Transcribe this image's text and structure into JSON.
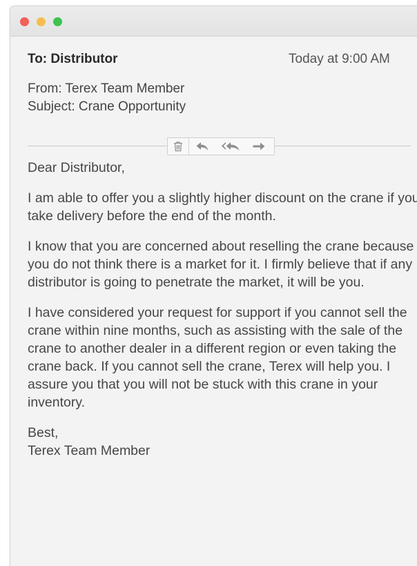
{
  "window": {
    "controls": [
      "close",
      "minimize",
      "maximize"
    ],
    "colors": {
      "close": "#f2605a",
      "minimize": "#f7be4f",
      "maximize": "#3ec350"
    }
  },
  "header": {
    "to": "To: Distributor",
    "date": "Today at 9:00 AM",
    "from": "From: Terex Team Member",
    "subject": "Subject: Crane Opportunity"
  },
  "toolbar": {
    "icons": [
      "trash-icon",
      "reply-icon",
      "reply-all-icon",
      "forward-icon"
    ]
  },
  "message": {
    "greeting": "Dear Distributor,",
    "paragraphs": [
      "I am able to offer you a slightly higher discount on the crane if you take delivery before the end of the month.",
      "I know that you are concerned about reselling the crane because you do not think there is a market for it. I firmly believe that if any distributor is going to penetrate the market, it will be you.",
      "I have considered your request for support if you cannot sell the crane within nine months, such as assisting with the sale of the crane to another dealer in a different region or even taking the crane back. If you cannot sell the crane, Terex will help you. I assure you that you will not be stuck with this crane in your inventory."
    ],
    "closing": "Best,",
    "signature": "Terex Team Member"
  }
}
